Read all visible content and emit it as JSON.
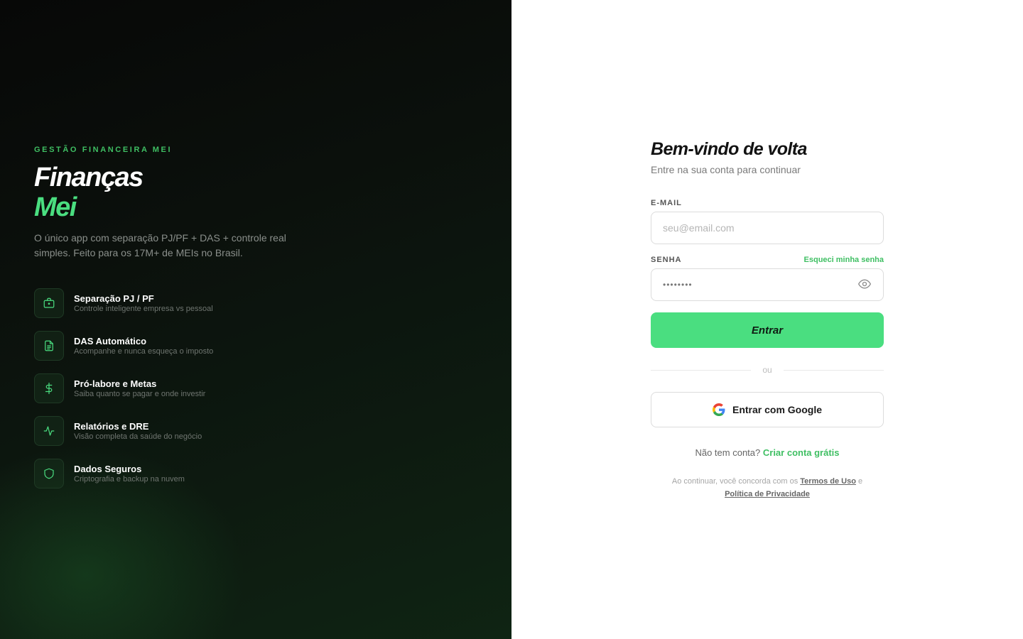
{
  "left": {
    "eyebrow": "GESTÃO FINANCEIRA MEI",
    "brand_line1": "Finanças",
    "brand_line2": "Mei",
    "description": "O único app com separação PJ/PF + DAS + controle real simples. Feito para os 17M+ de MEIs no Brasil.",
    "features": [
      {
        "icon": "briefcase-icon",
        "title": "Separação PJ / PF",
        "subtitle": "Controle inteligente empresa vs pessoal"
      },
      {
        "icon": "document-icon",
        "title": "DAS Automático",
        "subtitle": "Acompanhe e nunca esqueça o imposto"
      },
      {
        "icon": "dollar-icon",
        "title": "Pró-labore e Metas",
        "subtitle": "Saiba quanto se pagar e onde investir"
      },
      {
        "icon": "activity-icon",
        "title": "Relatórios e DRE",
        "subtitle": "Visão completa da saúde do negócio"
      },
      {
        "icon": "shield-icon",
        "title": "Dados Seguros",
        "subtitle": "Criptografia e backup na nuvem"
      }
    ]
  },
  "login": {
    "title": "Bem-vindo de volta",
    "subtitle": "Entre na sua conta para continuar",
    "email_label": "E-MAIL",
    "email_placeholder": "seu@email.com",
    "password_label": "SENHA",
    "forgot_link": "Esqueci minha senha",
    "password_value": "••••••••",
    "submit_label": "Entrar",
    "divider_text": "ou",
    "google_label": "Entrar com Google",
    "signup_prompt": "Não tem conta?",
    "signup_link": "Criar conta grátis",
    "terms_prefix": "Ao continuar, você concorda com os",
    "terms_link": "Termos de Uso",
    "terms_and": "e",
    "privacy_link": "Política de Privacidade"
  },
  "colors": {
    "accent": "#4ade80",
    "accent_text": "#3fbf63",
    "left_bg": "#0b100c"
  }
}
